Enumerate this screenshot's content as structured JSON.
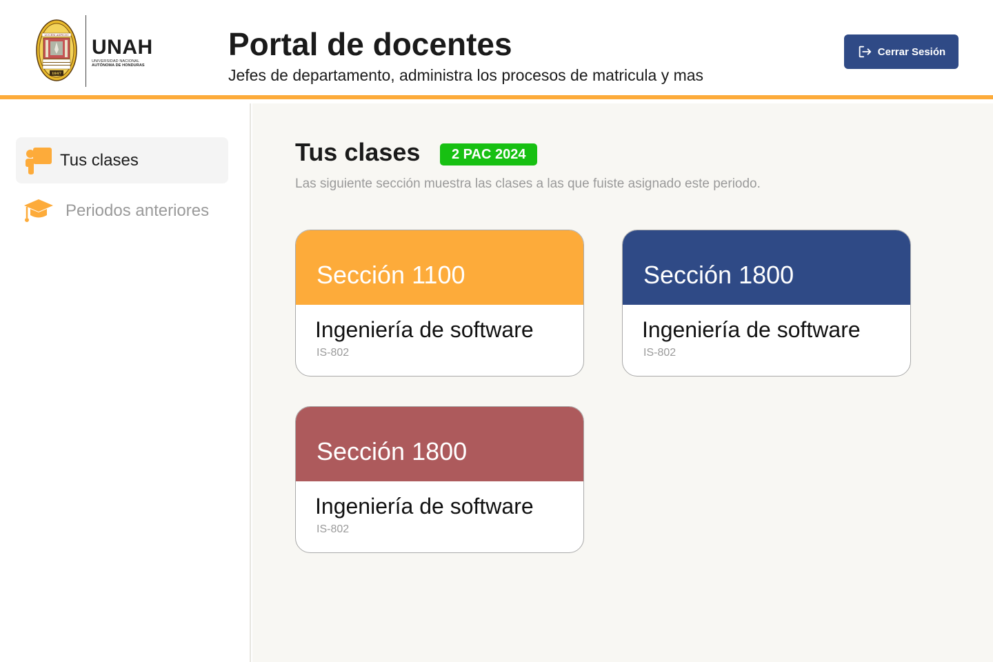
{
  "brand": {
    "acronym": "UNAH",
    "name_line1": "UNIVERSIDAD NACIONAL",
    "name_line2": "AUTÓNOMA DE HONDURAS",
    "seal_motto": "LUCEM ASPICIO",
    "seal_year": "1847"
  },
  "header": {
    "title": "Portal de docentes",
    "subtitle": "Jefes de departamento, administra los procesos de matricula y mas",
    "logout_label": "Cerrar Sesión"
  },
  "sidebar": {
    "items": [
      {
        "label": "Tus clases",
        "icon": "teacher-icon",
        "active": true
      },
      {
        "label": "Periodos anteriores",
        "icon": "graduation-cap-icon",
        "active": false
      }
    ]
  },
  "main": {
    "title": "Tus clases",
    "period_badge": "2 PAC 2024",
    "description": "Las siguiente sección  muestra las clases a las que fuiste asignado este periodo.",
    "classes": [
      {
        "section": "Sección 1100",
        "course": "Ingeniería de software",
        "code": "IS-802",
        "color": "#fdab3a"
      },
      {
        "section": "Sección 1800",
        "course": "Ingeniería de software",
        "code": "IS-802",
        "color": "#2f4a86"
      },
      {
        "section": "Sección 1800",
        "course": "Ingeniería de software",
        "code": "IS-802",
        "color": "#ad5a5c"
      }
    ]
  },
  "colors": {
    "accent": "#fdab3a",
    "primary": "#2f4a86",
    "badge": "#17c012",
    "background": "#f8f7f3"
  }
}
